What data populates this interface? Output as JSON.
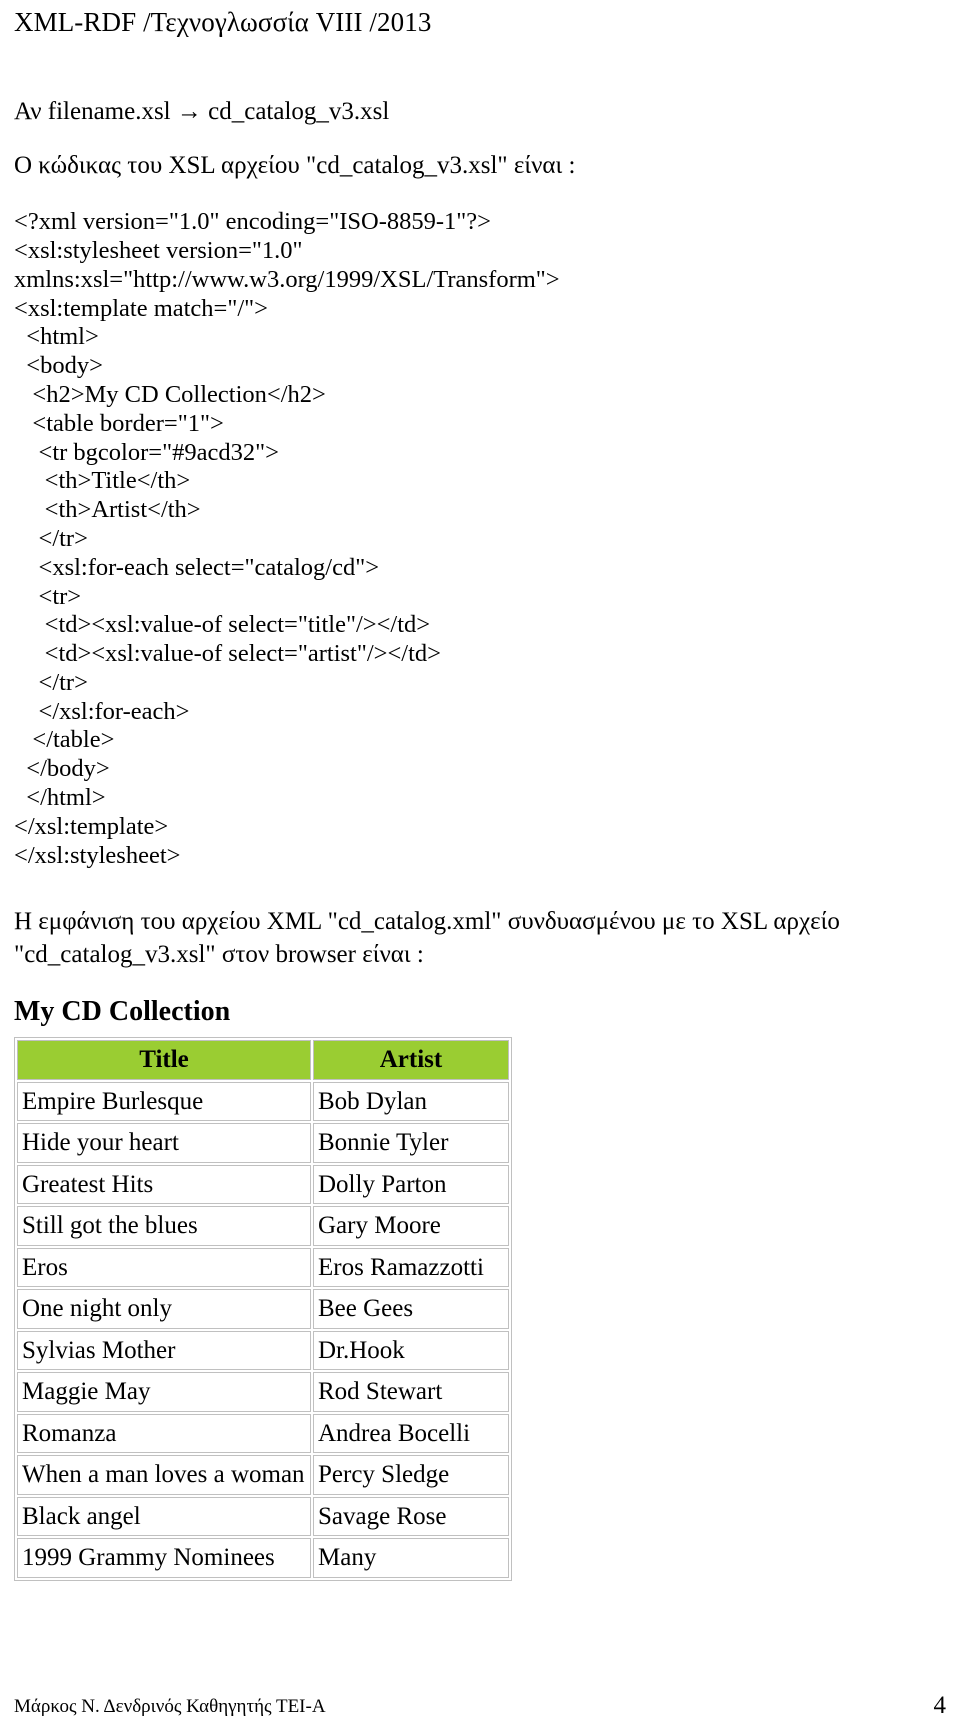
{
  "header": {
    "running_title": "XML-RDF /Τεχνογλωσσία VIII /2013"
  },
  "intro": {
    "filename_line_prefix": "Αν filename.xsl ",
    "arrow_icon": "→",
    "filename_line_suffix": " cd_catalog_v3.xsl",
    "code_intro": "Ο κώδικας του XSL αρχείου \"cd_catalog_v3.xsl\" είναι :"
  },
  "code": {
    "lines": [
      "<?xml version=\"1.0\" encoding=\"ISO-8859-1\"?>",
      "<xsl:stylesheet version=\"1.0\"",
      "xmlns:xsl=\"http://www.w3.org/1999/XSL/Transform\">",
      "<xsl:template match=\"/\">",
      "  <html>",
      "  <body>",
      "   <h2>My CD Collection</h2>",
      "   <table border=\"1\">",
      "    <tr bgcolor=\"#9acd32\">",
      "     <th>Title</th>",
      "     <th>Artist</th>",
      "    </tr>",
      "    <xsl:for-each select=\"catalog/cd\">",
      "    <tr>",
      "     <td><xsl:value-of select=\"title\"/></td>",
      "     <td><xsl:value-of select=\"artist\"/></td>",
      "    </tr>",
      "    </xsl:for-each>",
      "   </table>",
      "  </body>",
      "  </html>",
      "</xsl:template>",
      "</xsl:stylesheet>"
    ]
  },
  "render_note": {
    "text": "Η εμφάνιση του αρχείου XML \"cd_catalog.xml\" συνδυασμένου με το XSL αρχείο \"cd_catalog_v3.xsl\" στον browser είναι :"
  },
  "browser_output": {
    "heading": "My CD Collection",
    "header_bgcolor": "#9acd32",
    "columns": [
      "Title",
      "Artist"
    ],
    "rows": [
      [
        "Empire Burlesque",
        "Bob Dylan"
      ],
      [
        "Hide your heart",
        "Bonnie Tyler"
      ],
      [
        "Greatest Hits",
        "Dolly Parton"
      ],
      [
        "Still got the blues",
        "Gary Moore"
      ],
      [
        "Eros",
        "Eros Ramazzotti"
      ],
      [
        "One night only",
        "Bee Gees"
      ],
      [
        "Sylvias Mother",
        "Dr.Hook"
      ],
      [
        "Maggie May",
        "Rod Stewart"
      ],
      [
        "Romanza",
        "Andrea Bocelli"
      ],
      [
        "When a man loves a woman",
        "Percy Sledge"
      ],
      [
        "Black angel",
        "Savage Rose"
      ],
      [
        "1999 Grammy Nominees",
        "Many"
      ]
    ]
  },
  "footer": {
    "author": "Μάρκος Ν. Δενδρινός Καθηγητής ΤΕΙ-Α",
    "page_number": "4"
  }
}
